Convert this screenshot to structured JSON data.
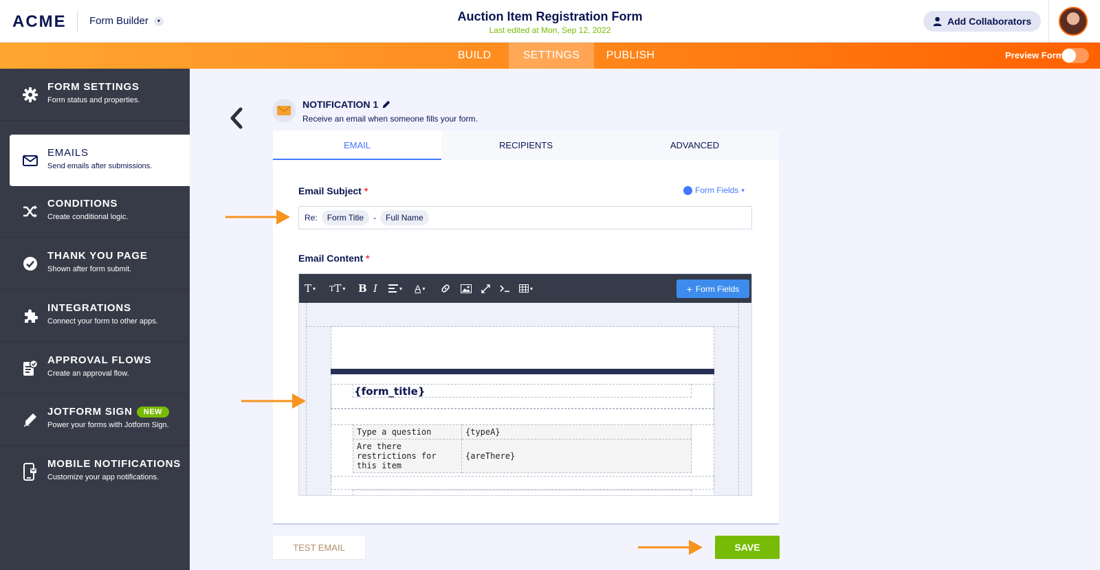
{
  "header": {
    "logo": "ACME",
    "app_name": "Form Builder",
    "form_title": "Auction Item Registration Form",
    "last_edited": "Last edited at Mon, Sep 12, 2022",
    "add_collaborators": "Add Collaborators"
  },
  "nav": {
    "tabs": [
      {
        "label": "BUILD",
        "active": false
      },
      {
        "label": "SETTINGS",
        "active": true
      },
      {
        "label": "PUBLISH",
        "active": false
      }
    ],
    "preview_label": "Preview Form",
    "preview_enabled": false
  },
  "sidebar": {
    "items": [
      {
        "icon": "gear-icon",
        "title": "FORM SETTINGS",
        "subtitle": "Form status and properties.",
        "active": false
      },
      {
        "icon": "envelope-icon",
        "title": "EMAILS",
        "subtitle": "Send emails after submissions.",
        "active": true
      },
      {
        "icon": "shuffle-icon",
        "title": "CONDITIONS",
        "subtitle": "Create conditional logic.",
        "active": false
      },
      {
        "icon": "check-circle-icon",
        "title": "THANK YOU PAGE",
        "subtitle": "Shown after form submit.",
        "active": false
      },
      {
        "icon": "puzzle-icon",
        "title": "INTEGRATIONS",
        "subtitle": "Connect your form to other apps.",
        "active": false
      },
      {
        "icon": "approval-icon",
        "title": "APPROVAL FLOWS",
        "subtitle": "Create an approval flow.",
        "active": false
      },
      {
        "icon": "pen-icon",
        "title": "JOTFORM SIGN",
        "badge": "NEW",
        "subtitle": "Power your forms with Jotform Sign.",
        "active": false
      },
      {
        "icon": "mobile-icon",
        "title": "MOBILE NOTIFICATIONS",
        "subtitle": "Customize your app notifications.",
        "active": false
      }
    ]
  },
  "notification": {
    "title": "NOTIFICATION 1",
    "subtitle": "Receive an email when someone fills your form."
  },
  "tabs": [
    {
      "label": "EMAIL",
      "active": true
    },
    {
      "label": "RECIPIENTS",
      "active": false
    },
    {
      "label": "ADVANCED",
      "active": false
    }
  ],
  "subject": {
    "label": "Email Subject",
    "form_fields_link": "Form Fields",
    "prefix": "Re:",
    "tag1": "Form Title",
    "separator": "-",
    "tag2": "Full Name"
  },
  "content": {
    "label": "Email Content",
    "form_fields_button": "Form Fields",
    "form_title_placeholder": "{form_title}",
    "rows": [
      {
        "question": "Type a question",
        "answer": "{typeA}"
      },
      {
        "question": "Are there restrictions for this item",
        "answer": "{areThere}"
      }
    ]
  },
  "footer": {
    "test_email": "TEST EMAIL",
    "save": "SAVE"
  },
  "colors": {
    "accent_orange": "#ff6100",
    "save_green": "#78bb07",
    "link_blue": "#4277ff",
    "sidebar_bg": "#373b48",
    "arrow_orange": "#f7931e"
  }
}
